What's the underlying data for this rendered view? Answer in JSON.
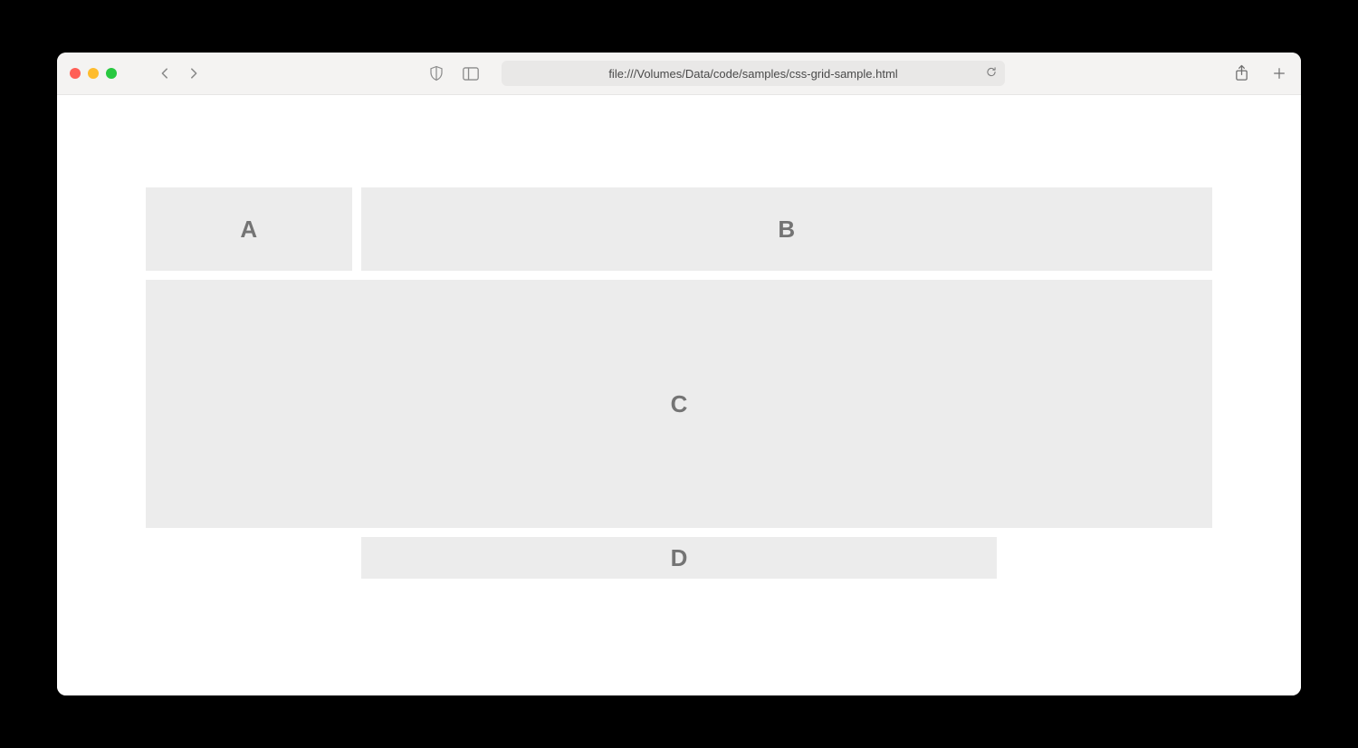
{
  "address_bar": {
    "url": "file:///Volumes/Data/code/samples/css-grid-sample.html"
  },
  "grid": {
    "cells": {
      "a": "A",
      "b": "B",
      "c": "C",
      "d": "D"
    }
  }
}
